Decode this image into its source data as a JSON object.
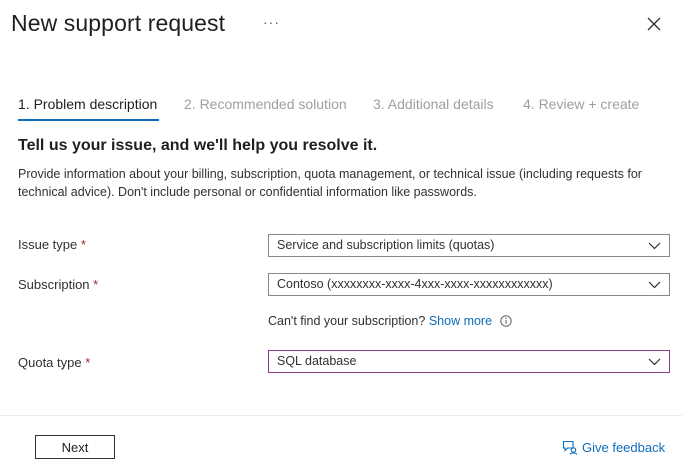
{
  "header": {
    "title": "New support request",
    "more_label": "···"
  },
  "steps": [
    {
      "label": "1. Problem description",
      "active": true
    },
    {
      "label": "2. Recommended solution",
      "active": false
    },
    {
      "label": "3. Additional details",
      "active": false
    },
    {
      "label": "4. Review + create",
      "active": false
    }
  ],
  "content": {
    "heading": "Tell us your issue, and we'll help you resolve it.",
    "description": "Provide information about your billing, subscription, quota management, or technical issue (including requests for technical advice). Don't include personal or confidential information like passwords."
  },
  "form": {
    "issue_type": {
      "label": "Issue type",
      "required_mark": "*",
      "value": "Service and subscription limits (quotas)"
    },
    "subscription": {
      "label": "Subscription",
      "required_mark": "*",
      "value": "Contoso (xxxxxxxx-xxxx-4xxx-xxxx-xxxxxxxxxxxx)"
    },
    "cant_find": {
      "text": "Can't find your subscription?",
      "link": "Show more"
    },
    "quota_type": {
      "label": "Quota type",
      "required_mark": "*",
      "value": "SQL database"
    }
  },
  "footer": {
    "next_label": "Next",
    "feedback_label": "Give feedback"
  },
  "colors": {
    "accent": "#0f6cbd",
    "required": "#a4262c",
    "focus_border": "#8a3a8a"
  },
  "icons": [
    "more-icon",
    "close-icon",
    "chevron-down-icon",
    "info-icon",
    "feedback-icon"
  ]
}
